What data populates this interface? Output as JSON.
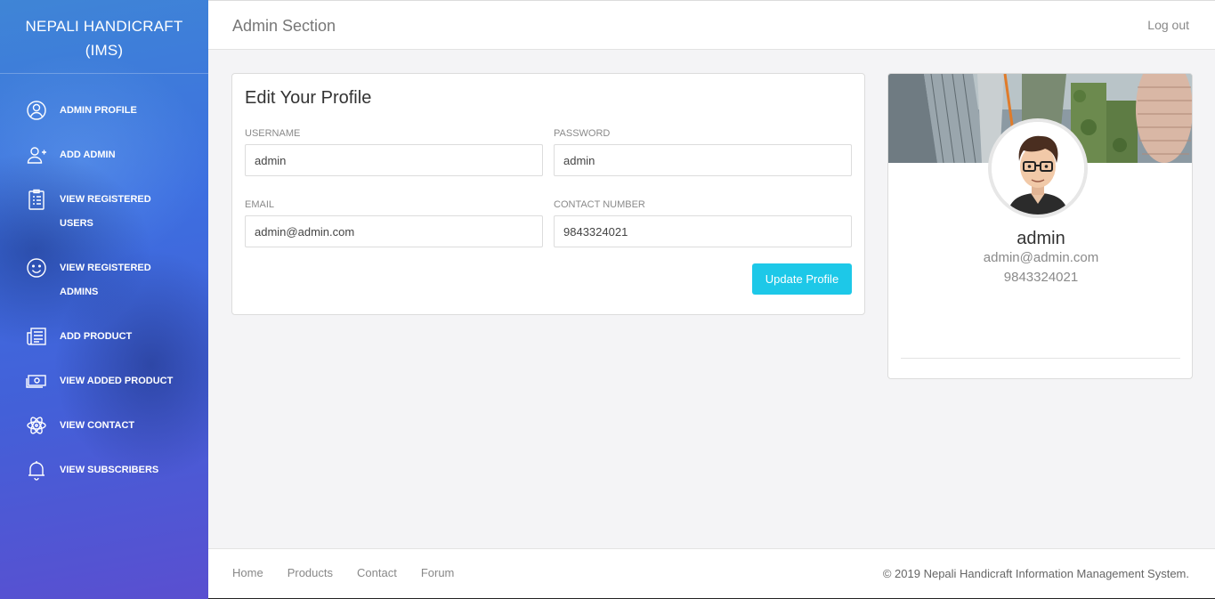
{
  "sidebar": {
    "brand_line1": "NEPALI HANDICRAFT",
    "brand_line2": "(IMS)",
    "items": [
      {
        "label": "ADMIN PROFILE",
        "icon": "user-circle-icon"
      },
      {
        "label": "ADD ADMIN",
        "icon": "add-user-icon"
      },
      {
        "label": "VIEW REGISTERED USERS",
        "icon": "clipboard-list-icon"
      },
      {
        "label": "VIEW REGISTERED ADMINS",
        "icon": "smiley-icon"
      },
      {
        "label": "ADD PRODUCT",
        "icon": "newspaper-icon"
      },
      {
        "label": "VIEW ADDED PRODUCT",
        "icon": "money-icon"
      },
      {
        "label": "VIEW CONTACT",
        "icon": "atom-icon"
      },
      {
        "label": "VIEW SUBSCRIBERS",
        "icon": "bell-icon"
      }
    ]
  },
  "header": {
    "title": "Admin Section",
    "logout": "Log out"
  },
  "edit_profile": {
    "heading": "Edit Your Profile",
    "username_label": "USERNAME",
    "username_value": "admin",
    "password_label": "PASSWORD",
    "password_value": "admin",
    "email_label": "EMAIL",
    "email_value": "admin@admin.com",
    "contact_label": "CONTACT NUMBER",
    "contact_value": "9843324021",
    "update_button": "Update Profile"
  },
  "profile_card": {
    "name": "admin",
    "email": "admin@admin.com",
    "phone": "9843324021"
  },
  "footer": {
    "links": [
      "Home",
      "Products",
      "Contact",
      "Forum"
    ],
    "copyright": "© 2019 Nepali Handicraft Information Management System."
  },
  "colors": {
    "accent_button": "#1dc8e8",
    "sidebar_gradient_top": "#3f85d6",
    "sidebar_gradient_bottom": "#5a4fd0"
  }
}
